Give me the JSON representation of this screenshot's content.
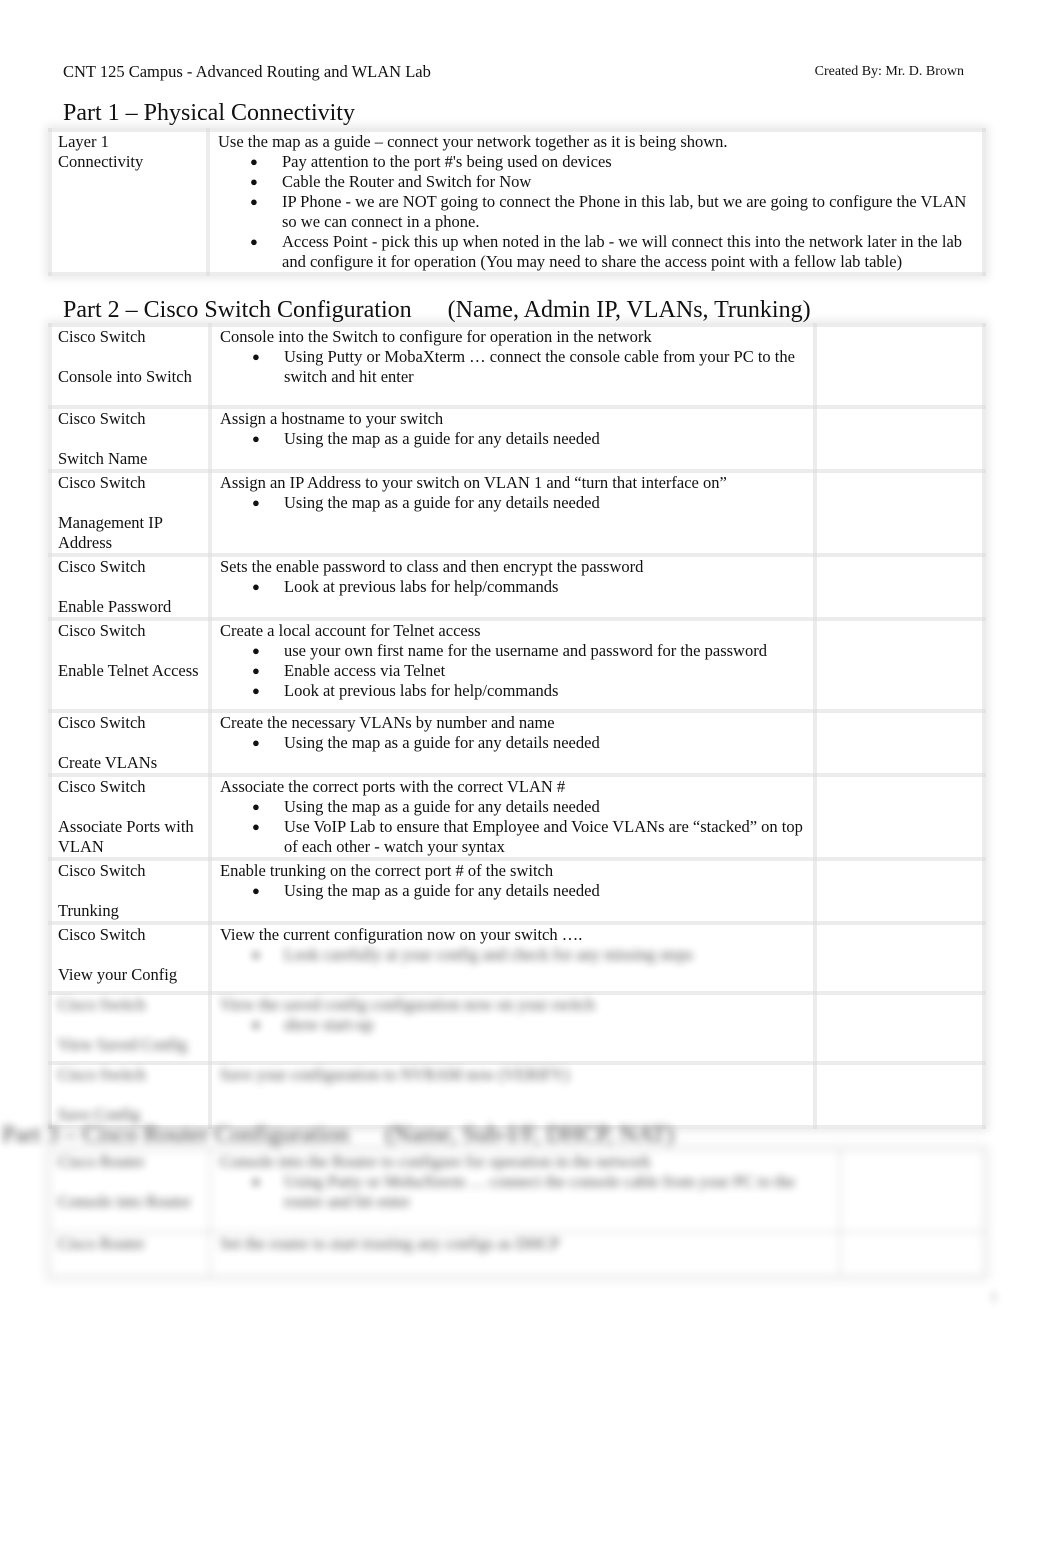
{
  "header": {
    "title": "CNT 125 Campus - Advanced Routing and WLAN Lab",
    "created_by": "Created By:  Mr. D. Brown"
  },
  "part1": {
    "title": "Part 1 – Physical Connectivity",
    "rows": [
      {
        "label_top": "Layer 1",
        "label_bottom": "Connectivity",
        "description": "Use the map as a guide – connect your network together as it is being shown.",
        "bullets": [
          "Pay attention to the port #'s being used on devices",
          "Cable the Router and Switch for Now",
          "IP Phone - we are NOT going to connect the Phone in this lab, but we are going to configure the VLAN so we can connect in a phone.",
          "Access Point - pick this up when noted in the lab - we will connect this into the network later in the lab and configure it for operation (You may need to share the access point with a fellow lab table)"
        ]
      }
    ]
  },
  "part2": {
    "title": "Part 2 – Cisco Switch Configuration      (Name, Admin IP, VLANs, Trunking)",
    "rows": [
      {
        "device": "Cisco Switch",
        "task": "Console into Switch",
        "description": " Console into the Switch to configure for operation in the network",
        "bullets": [
          "Using Putty or MobaXterm … connect the console cable from your PC to the switch and hit  enter"
        ]
      },
      {
        "device": "Cisco Switch",
        "task": "Switch Name",
        "description": "Assign a hostname  to your switch",
        "bullets": [
          "Using the map as a guide for any details needed"
        ]
      },
      {
        "device": "Cisco Switch",
        "task": "Management IP Address",
        "description": "Assign an IP Address  to your switch on VLAN 1  and “turn that interface on”",
        "bullets": [
          "Using the map as a guide for any details needed"
        ]
      },
      {
        "device": "Cisco Switch",
        "task": "Enable Password",
        "description": "Sets the enable  password to  class  and then encrypt  the password",
        "bullets": [
          "Look at previous labs for help/commands"
        ]
      },
      {
        "device": "Cisco Switch",
        "task": "Enable Telnet Access",
        "description": "Create a local account for Telnet access",
        "bullets": [
          "use your own first name for the username and password   for the password",
          "Enable access via Telnet",
          "Look at previous labs for help/commands"
        ]
      },
      {
        "device": "Cisco Switch",
        "task": "Create VLANs",
        "description": "Create the necessary VLANs by number  and name",
        "bullets": [
          "Using the map as a guide for any details needed"
        ]
      },
      {
        "device": "Cisco Switch",
        "task": "Associate Ports with VLAN",
        "description": "Associate the correct ports  with the correct VLAN #",
        "bullets": [
          "Using the map as a guide for any details needed",
          "Use VoIP Lab to ensure that Employee and Voice VLANs are “stacked” on top of each other - watch your syntax"
        ]
      },
      {
        "device": "Cisco Switch",
        "task": "Trunking",
        "description": "Enable trunking   on the correct port # of the switch",
        "bullets": [
          "Using the map as a guide for any details needed"
        ]
      },
      {
        "device": "Cisco Switch",
        "task": "View your Config",
        "description": "View the current configuration now on your switch ….",
        "bullets": [
          "Look carefully at your config and check for any missing steps"
        ],
        "bullets_blurred": true
      },
      {
        "device": "Cisco Switch",
        "task": "View Saved Config",
        "description": "View the saved config configuration now on your switch",
        "bullets": [
          "show start-up"
        ],
        "blurred": true
      },
      {
        "device": "Cisco Switch",
        "task": "Save Config",
        "description": "Save your configuration to NVRAM now (VERIFY)",
        "bullets": [],
        "blurred": true
      }
    ]
  },
  "part3": {
    "title": "Part 3 – Cisco Router Configuration      (Name, Sub-I/F, DHCP, NAT)",
    "blurred": true,
    "rows": [
      {
        "device": "Cisco Router",
        "task": "Console into Router",
        "description": " Console into the Router to configure for operation in the network",
        "bullets": [
          "Using Putty or MobaXterm … connect the console cable from your PC to the router and hit  enter"
        ]
      },
      {
        "device": "Cisco Router",
        "task": "",
        "description": "Set the router to start trusting any configs as DHCP",
        "bullets": []
      }
    ]
  },
  "footer": {
    "page_number": "1"
  }
}
